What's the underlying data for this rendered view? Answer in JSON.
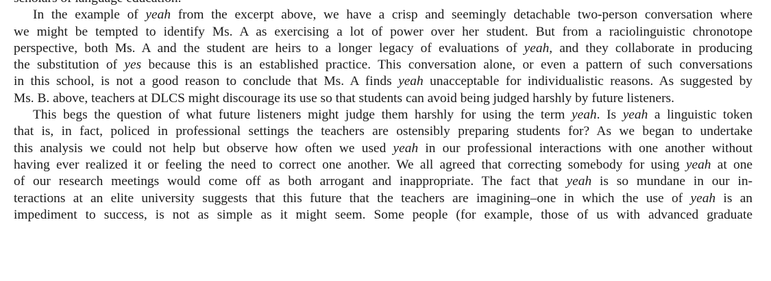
{
  "document": {
    "lines": [
      {
        "indent": false,
        "last": true,
        "segments": [
          {
            "text": "scholars of language education.",
            "italic": false
          }
        ]
      },
      {
        "indent": true,
        "last": false,
        "segments": [
          {
            "text": "In the example of ",
            "italic": false
          },
          {
            "text": "yeah",
            "italic": true
          },
          {
            "text": " from the excerpt above, we have a crisp and seemingly detachable two-person conversation where",
            "italic": false
          }
        ]
      },
      {
        "indent": false,
        "last": false,
        "segments": [
          {
            "text": "we might be tempted to identify Ms. A as exercising a lot of power over her student. But from a raciolinguistic chronotope",
            "italic": false
          }
        ]
      },
      {
        "indent": false,
        "last": false,
        "segments": [
          {
            "text": "perspective, both Ms. A and the student are heirs to a longer legacy of evaluations of ",
            "italic": false
          },
          {
            "text": "yeah",
            "italic": true
          },
          {
            "text": ", and they collaborate in producing",
            "italic": false
          }
        ]
      },
      {
        "indent": false,
        "last": false,
        "segments": [
          {
            "text": "the substitution of ",
            "italic": false
          },
          {
            "text": "yes",
            "italic": true
          },
          {
            "text": " because this is an established practice. This conversation alone, or even a pattern of such conversations",
            "italic": false
          }
        ]
      },
      {
        "indent": false,
        "last": false,
        "segments": [
          {
            "text": "in this school, is not a good reason to conclude that Ms. A finds ",
            "italic": false
          },
          {
            "text": "yeah",
            "italic": true
          },
          {
            "text": " unacceptable for individualistic reasons. As suggested by",
            "italic": false
          }
        ]
      },
      {
        "indent": false,
        "last": true,
        "segments": [
          {
            "text": "Ms. B. above, teachers at DLCS might discourage its use so that students can avoid being judged harshly by future listeners.",
            "italic": false
          }
        ]
      },
      {
        "indent": true,
        "last": false,
        "segments": [
          {
            "text": "This begs the question of what future listeners might judge them harshly for using the term ",
            "italic": false
          },
          {
            "text": "yeah",
            "italic": true
          },
          {
            "text": ". Is ",
            "italic": false
          },
          {
            "text": "yeah",
            "italic": true
          },
          {
            "text": " a linguistic token",
            "italic": false
          }
        ]
      },
      {
        "indent": false,
        "last": false,
        "segments": [
          {
            "text": "that is, in fact, policed in professional settings the teachers are ostensibly preparing students for? As we began to undertake",
            "italic": false
          }
        ]
      },
      {
        "indent": false,
        "last": false,
        "segments": [
          {
            "text": "this analysis we could not help but observe how often we used ",
            "italic": false
          },
          {
            "text": "yeah",
            "italic": true
          },
          {
            "text": " in our professional interactions with one another without",
            "italic": false
          }
        ]
      },
      {
        "indent": false,
        "last": false,
        "segments": [
          {
            "text": "having ever realized it or feeling the need to correct one another. We all agreed that correcting somebody for using ",
            "italic": false
          },
          {
            "text": "yeah",
            "italic": true
          },
          {
            "text": " at one",
            "italic": false
          }
        ]
      },
      {
        "indent": false,
        "last": false,
        "segments": [
          {
            "text": "of our research meetings would come off as both arrogant and inappropriate. The fact that ",
            "italic": false
          },
          {
            "text": "yeah",
            "italic": true
          },
          {
            "text": " is so mundane in our in-",
            "italic": false
          }
        ]
      },
      {
        "indent": false,
        "last": false,
        "segments": [
          {
            "text": "teractions at an elite university suggests that this future that the teachers are imagining–one in which the use of ",
            "italic": false
          },
          {
            "text": "yeah",
            "italic": true
          },
          {
            "text": " is an",
            "italic": false
          }
        ]
      },
      {
        "indent": false,
        "last": false,
        "segments": [
          {
            "text": "impediment to success, is not as simple as it might seem. Some people (for example, those of us with advanced graduate",
            "italic": false
          }
        ]
      }
    ]
  }
}
